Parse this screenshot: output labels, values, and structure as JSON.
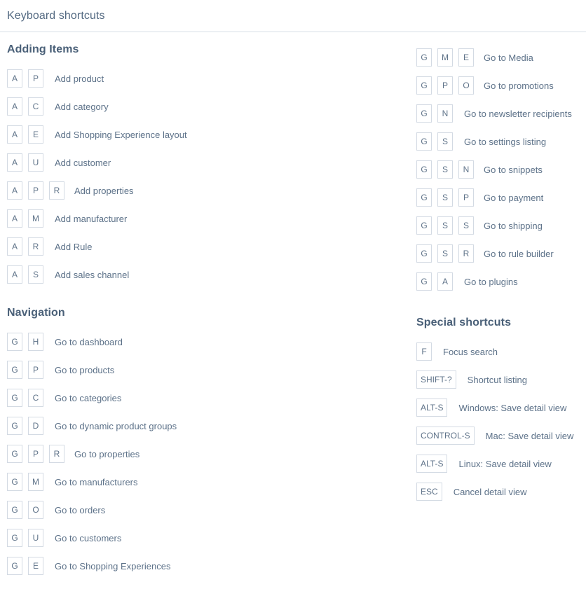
{
  "header": {
    "title": "Keyboard shortcuts"
  },
  "colors": {
    "background": "#ffffff",
    "divider": "#d8dfe7",
    "heading_text": "#4a6078",
    "label_text": "#5d7289",
    "key_border": "#d3dae3",
    "key_text": "#5f7389",
    "title_text": "#546a82"
  },
  "sections": [
    {
      "id": "adding-items",
      "column": "left",
      "heading": "Adding Items",
      "shortcuts": [
        {
          "keys": [
            "A",
            "P"
          ],
          "label": "Add product"
        },
        {
          "keys": [
            "A",
            "C"
          ],
          "label": "Add category"
        },
        {
          "keys": [
            "A",
            "E"
          ],
          "label": "Add Shopping Experience layout"
        },
        {
          "keys": [
            "A",
            "U"
          ],
          "label": "Add customer"
        },
        {
          "keys": [
            "A",
            "P",
            "R"
          ],
          "label": "Add properties"
        },
        {
          "keys": [
            "A",
            "M"
          ],
          "label": "Add manufacturer"
        },
        {
          "keys": [
            "A",
            "R"
          ],
          "label": "Add Rule"
        },
        {
          "keys": [
            "A",
            "S"
          ],
          "label": "Add sales channel"
        }
      ]
    },
    {
      "id": "navigation",
      "column": "left",
      "heading": "Navigation",
      "shortcuts": [
        {
          "keys": [
            "G",
            "H"
          ],
          "label": "Go to dashboard"
        },
        {
          "keys": [
            "G",
            "P"
          ],
          "label": "Go to products"
        },
        {
          "keys": [
            "G",
            "C"
          ],
          "label": "Go to categories"
        },
        {
          "keys": [
            "G",
            "D"
          ],
          "label": "Go to dynamic product groups"
        },
        {
          "keys": [
            "G",
            "P",
            "R"
          ],
          "label": "Go to properties"
        },
        {
          "keys": [
            "G",
            "M"
          ],
          "label": "Go to manufacturers"
        },
        {
          "keys": [
            "G",
            "O"
          ],
          "label": "Go to orders"
        },
        {
          "keys": [
            "G",
            "U"
          ],
          "label": "Go to customers"
        },
        {
          "keys": [
            "G",
            "E"
          ],
          "label": "Go to Shopping Experiences"
        }
      ]
    },
    {
      "id": "navigation-continued",
      "column": "right",
      "heading": "",
      "shortcuts": [
        {
          "keys": [
            "G",
            "M",
            "E"
          ],
          "label": "Go to Media"
        },
        {
          "keys": [
            "G",
            "P",
            "O"
          ],
          "label": "Go to promotions"
        },
        {
          "keys": [
            "G",
            "N"
          ],
          "label": "Go to newsletter recipients"
        },
        {
          "keys": [
            "G",
            "S"
          ],
          "label": "Go to settings listing"
        },
        {
          "keys": [
            "G",
            "S",
            "N"
          ],
          "label": "Go to snippets"
        },
        {
          "keys": [
            "G",
            "S",
            "P"
          ],
          "label": "Go to payment"
        },
        {
          "keys": [
            "G",
            "S",
            "S"
          ],
          "label": "Go to shipping"
        },
        {
          "keys": [
            "G",
            "S",
            "R"
          ],
          "label": "Go to rule builder"
        },
        {
          "keys": [
            "G",
            "A"
          ],
          "label": "Go to plugins"
        }
      ]
    },
    {
      "id": "special-shortcuts",
      "column": "right",
      "heading": "Special shortcuts",
      "shortcuts": [
        {
          "keys": [
            "F"
          ],
          "label": "Focus search"
        },
        {
          "keys": [
            "SHIFT-?"
          ],
          "label": "Shortcut listing"
        },
        {
          "keys": [
            "ALT-S"
          ],
          "label": "Windows: Save detail view"
        },
        {
          "keys": [
            "CONTROL-S"
          ],
          "label": "Mac: Save detail view"
        },
        {
          "keys": [
            "ALT-S"
          ],
          "label": "Linux: Save detail view"
        },
        {
          "keys": [
            "ESC"
          ],
          "label": "Cancel detail view"
        }
      ]
    }
  ]
}
